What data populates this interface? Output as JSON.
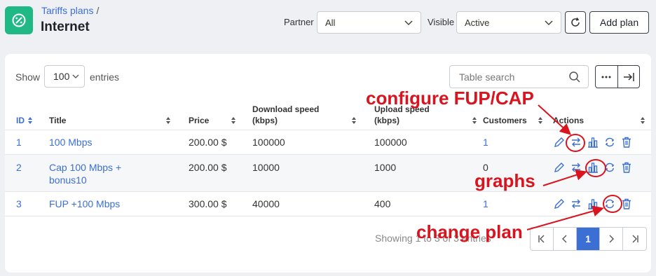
{
  "header": {
    "breadcrumb": "Tariffs plans",
    "breadcrumb_sep": "/",
    "title": "Internet",
    "partner_label": "Partner",
    "partner_value": "All",
    "visible_label": "Visible",
    "visible_value": "Active",
    "add_plan_label": "Add plan"
  },
  "toolbar": {
    "show_label": "Show",
    "entries_value": "100",
    "entries_label": "entries",
    "search_placeholder": "Table search"
  },
  "table": {
    "headers": {
      "id": "ID",
      "title": "Title",
      "price": "Price",
      "download_1": "Download speed",
      "download_2": "(kbps)",
      "upload_1": "Upload speed",
      "upload_2": "(kbps)",
      "customers": "Customers",
      "actions": "Actions"
    },
    "rows": [
      {
        "id": "1",
        "title_1": "100 Mbps",
        "title_2": "",
        "price": "200.00 $",
        "download": "100000",
        "upload": "100000",
        "customers": "1"
      },
      {
        "id": "2",
        "title_1": "Cap 100 Mbps +",
        "title_2": "bonus10",
        "price": "200.00 $",
        "download": "10000",
        "upload": "1000",
        "customers": "0"
      },
      {
        "id": "3",
        "title_1": "FUP +100 Mbps",
        "title_2": "",
        "price": "300.00 $",
        "download": "40000",
        "upload": "400",
        "customers": "1"
      }
    ]
  },
  "footer": {
    "showing": "Showing 1 to 3 of 3 entries",
    "current_page": "1"
  },
  "annotations": {
    "fup": "configure FUP/CAP",
    "graphs": "graphs",
    "change": "change plan"
  },
  "colors": {
    "accent": "#3b6fd4",
    "brand": "#20b885",
    "annotation": "#d9141e"
  }
}
